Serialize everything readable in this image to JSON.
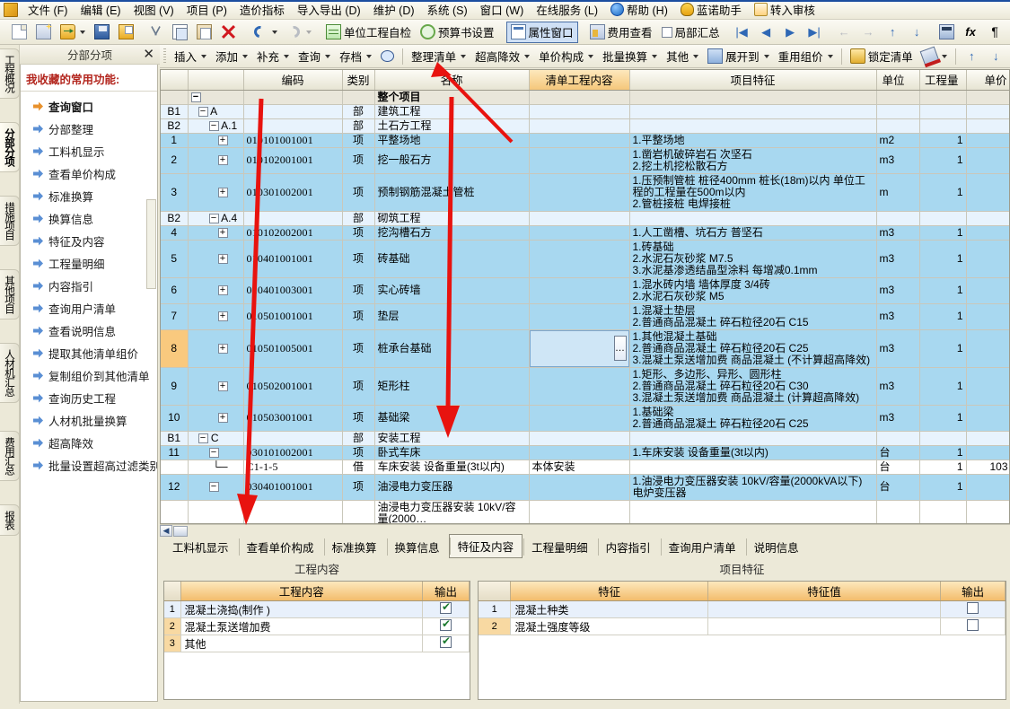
{
  "menubar": {
    "items": [
      {
        "label": "文件 (F)"
      },
      {
        "label": "编辑 (E)"
      },
      {
        "label": "视图 (V)"
      },
      {
        "label": "项目 (P)"
      },
      {
        "label": "造价指标"
      },
      {
        "label": "导入导出 (D)"
      },
      {
        "label": "维护 (D)"
      },
      {
        "label": "系统 (S)"
      },
      {
        "label": "窗口 (W)"
      },
      {
        "label": "在线服务 (L)"
      },
      {
        "label": "帮助 (H)",
        "icon": "help-icon"
      },
      {
        "label": "蓝诺助手",
        "icon": "helmet-icon"
      },
      {
        "label": "转入审核",
        "icon": "audit-icon"
      }
    ]
  },
  "toolbar1": {
    "buttons": [
      {
        "name": "new-document",
        "icon": "new-document-icon",
        "label": ""
      },
      {
        "name": "new-project",
        "icon": "new-project-icon",
        "label": ""
      },
      {
        "name": "open",
        "icon": "open-folder-icon",
        "label": "",
        "dropdown": true
      },
      {
        "name": "save",
        "icon": "save-icon",
        "label": ""
      },
      {
        "name": "save-as",
        "icon": "save-as-icon",
        "label": ""
      },
      {
        "name": "cut",
        "icon": "scissors-icon",
        "label": ""
      },
      {
        "name": "copy",
        "icon": "copy-icon",
        "label": ""
      },
      {
        "name": "paste",
        "icon": "paste-icon",
        "label": ""
      },
      {
        "name": "delete",
        "icon": "delete-x-icon",
        "label": ""
      },
      {
        "name": "undo",
        "icon": "undo-icon",
        "label": "",
        "dropdown": true
      },
      {
        "name": "redo",
        "icon": "redo-icon",
        "label": "",
        "dropdown": true,
        "disabled": true
      }
    ],
    "labeled": [
      {
        "name": "unit-project-self-check",
        "icon": "grid-check-icon",
        "label": "单位工程自检"
      },
      {
        "name": "budget-book-settings",
        "icon": "gear-icon",
        "label": "预算书设置"
      },
      {
        "name": "property-window",
        "icon": "property-window-icon",
        "label": "属性窗口",
        "active": true
      },
      {
        "name": "fee-view",
        "icon": "fee-icon",
        "label": "费用查看"
      },
      {
        "name": "local-summary",
        "icon": "checkbox-icon",
        "label": "局部汇总"
      }
    ],
    "nav": [
      {
        "name": "first-record",
        "glyph": "|◀"
      },
      {
        "name": "prev-record",
        "glyph": "◀"
      },
      {
        "name": "next-record",
        "glyph": "▶"
      },
      {
        "name": "last-record",
        "glyph": "▶|"
      }
    ],
    "nav2": [
      {
        "name": "back",
        "glyph": "←",
        "disabled": true
      },
      {
        "name": "forward",
        "glyph": "→",
        "disabled": true
      },
      {
        "name": "move-up",
        "glyph": "↑"
      },
      {
        "name": "move-down",
        "glyph": "↓"
      }
    ],
    "tools": [
      {
        "name": "calculator",
        "icon": "calculator-icon"
      },
      {
        "name": "formula",
        "icon": "fx-icon",
        "glyph": "fx"
      },
      {
        "name": "paragraph",
        "icon": "paragraph-icon",
        "glyph": "¶"
      },
      {
        "name": "book",
        "icon": "book-icon"
      },
      {
        "name": "list",
        "icon": "list-icon"
      }
    ]
  },
  "toolbar2": {
    "buttons": [
      {
        "name": "insert",
        "label": "插入",
        "dropdown": true
      },
      {
        "name": "add",
        "label": "添加",
        "dropdown": true
      },
      {
        "name": "supplement",
        "label": "补充",
        "dropdown": true
      },
      {
        "name": "query",
        "label": "查询",
        "dropdown": true
      },
      {
        "name": "archive",
        "label": "存档",
        "dropdown": true
      },
      {
        "name": "find",
        "label": "",
        "icon": "binoculars-icon"
      },
      {
        "name": "organize-list",
        "label": "整理清单",
        "dropdown": true
      },
      {
        "name": "super-high-derating",
        "label": "超高降效",
        "dropdown": true
      },
      {
        "name": "unit-price-composition",
        "label": "单价构成",
        "dropdown": true
      },
      {
        "name": "batch-conversion",
        "label": "批量换算",
        "dropdown": true
      },
      {
        "name": "other",
        "label": "其他",
        "dropdown": true
      },
      {
        "name": "expand-to",
        "label": "展开到",
        "icon": "expand-icon",
        "dropdown": true
      },
      {
        "name": "reuse-pricing",
        "label": "重用组价",
        "dropdown": true
      },
      {
        "name": "lock-list",
        "label": "锁定清单",
        "icon": "lock-icon"
      },
      {
        "name": "format-painter",
        "label": "",
        "icon": "paint-icon",
        "dropdown": true
      },
      {
        "name": "move-up",
        "label": "",
        "icon": "arrow-up-icon"
      },
      {
        "name": "move-down",
        "label": "",
        "icon": "arrow-down-icon"
      }
    ]
  },
  "vtabs": [
    {
      "label": "工程概况",
      "selected": false
    },
    {
      "label": "分部分项",
      "selected": true
    },
    {
      "label": "措施项目",
      "selected": false
    },
    {
      "label": "其他项目",
      "selected": false
    },
    {
      "label": "人材机汇总",
      "selected": false
    },
    {
      "label": "费用汇总",
      "selected": false
    },
    {
      "label": "报表",
      "selected": false
    }
  ],
  "sidebar": {
    "header": "分部分项",
    "close": "✕",
    "title": "我收藏的常用功能:",
    "items": [
      {
        "label": "查询窗口"
      },
      {
        "label": "分部整理"
      },
      {
        "label": "工料机显示"
      },
      {
        "label": "查看单价构成"
      },
      {
        "label": "标准换算"
      },
      {
        "label": "换算信息"
      },
      {
        "label": "特征及内容"
      },
      {
        "label": "工程量明细"
      },
      {
        "label": "内容指引"
      },
      {
        "label": "查询用户清单"
      },
      {
        "label": "查看说明信息"
      },
      {
        "label": "提取其他清单组价"
      },
      {
        "label": "复制组价到其他清单"
      },
      {
        "label": "查询历史工程"
      },
      {
        "label": "人材机批量换算"
      },
      {
        "label": "超高降效"
      },
      {
        "label": "批量设置超高过滤类别"
      }
    ]
  },
  "grid": {
    "columns": [
      {
        "key": "no",
        "label": ""
      },
      {
        "key": "tree",
        "label": ""
      },
      {
        "key": "code",
        "label": "编码"
      },
      {
        "key": "cat",
        "label": "类别"
      },
      {
        "key": "name",
        "label": "名称"
      },
      {
        "key": "qdc",
        "label": "清单工程内容",
        "highlight": true
      },
      {
        "key": "feat",
        "label": "项目特征"
      },
      {
        "key": "unit",
        "label": "单位"
      },
      {
        "key": "qty",
        "label": "工程量"
      },
      {
        "key": "price",
        "label": "单价"
      }
    ],
    "rows": [
      {
        "no": "",
        "style": "root",
        "tree": "−",
        "code": "",
        "cat": "",
        "name": "整个项目",
        "qdc": "",
        "feat": "",
        "unit": "",
        "qty": "",
        "price": ""
      },
      {
        "no": "B1",
        "style": "dept",
        "tree": "−",
        "treeLabel": "A",
        "indent": 1,
        "code": "",
        "cat": "部",
        "name": "建筑工程",
        "qdc": "",
        "feat": "",
        "unit": "",
        "qty": "",
        "price": ""
      },
      {
        "no": "B2",
        "style": "dept",
        "tree": "−",
        "treeLabel": "A.1",
        "indent": 2,
        "code": "",
        "cat": "部",
        "name": "土石方工程",
        "qdc": "",
        "feat": "",
        "unit": "",
        "qty": "",
        "price": ""
      },
      {
        "no": "1",
        "style": "item",
        "tree": "+",
        "indent": 3,
        "code": "010101001001",
        "cat": "项",
        "name": "平整场地",
        "qdc": "",
        "feat": "1.平整场地",
        "unit": "m2",
        "qty": "1",
        "price": ""
      },
      {
        "no": "2",
        "style": "item",
        "tree": "+",
        "indent": 3,
        "code": "010102001001",
        "cat": "项",
        "name": "挖一般石方",
        "qdc": "",
        "feat": "1.凿岩机破碎岩石  次坚石\n2.挖土机挖松散石方",
        "unit": "m3",
        "qty": "1",
        "price": ""
      },
      {
        "no": "3",
        "style": "item",
        "tree": "+",
        "indent": 3,
        "code": "010301002001",
        "cat": "项",
        "name": "预制钢筋混凝土管桩",
        "qdc": "",
        "feat": "1.压预制管桩  桩径400mm  桩长(18m)以内  单位工程的工程量在500m以内\n2.管桩接桩  电焊接桩",
        "unit": "m",
        "qty": "1",
        "price": ""
      },
      {
        "no": "B2",
        "style": "dept",
        "tree": "−",
        "treeLabel": "A.4",
        "indent": 2,
        "code": "",
        "cat": "部",
        "name": "砌筑工程",
        "qdc": "",
        "feat": "",
        "unit": "",
        "qty": "",
        "price": ""
      },
      {
        "no": "4",
        "style": "item",
        "tree": "+",
        "indent": 3,
        "code": "010102002001",
        "cat": "项",
        "name": "挖沟槽石方",
        "qdc": "",
        "feat": "1.人工凿槽、坑石方  普坚石",
        "unit": "m3",
        "qty": "1",
        "price": ""
      },
      {
        "no": "5",
        "style": "item",
        "tree": "+",
        "indent": 3,
        "code": "010401001001",
        "cat": "项",
        "name": "砖基础",
        "qdc": "",
        "feat": "1.砖基础\n2.水泥石灰砂浆  M7.5\n3.水泥基渗透结晶型涂料  每增减0.1mm",
        "unit": "m3",
        "qty": "1",
        "price": ""
      },
      {
        "no": "6",
        "style": "item",
        "tree": "+",
        "indent": 3,
        "code": "010401003001",
        "cat": "项",
        "name": "实心砖墙",
        "qdc": "",
        "feat": "1.混水砖内墙  墙体厚度  3/4砖\n2.水泥石灰砂浆  M5",
        "unit": "m3",
        "qty": "1",
        "price": ""
      },
      {
        "no": "7",
        "style": "item",
        "tree": "+",
        "indent": 3,
        "code": "010501001001",
        "cat": "项",
        "name": "垫层",
        "qdc": "",
        "feat": "1.混凝土垫层\n2.普通商品混凝土  碎石粒径20石 C15",
        "unit": "m3",
        "qty": "1",
        "price": ""
      },
      {
        "no": "8",
        "style": "sel",
        "tree": "+",
        "indent": 3,
        "code": "010501005001",
        "cat": "项",
        "name": "桩承台基础",
        "qdc": "",
        "qdcSelected": true,
        "feat": "1.其他混凝土基础\n2.普通商品混凝土  碎石粒径20石  C25\n3.混凝土泵送增加费  商品混凝土 (不计算超高降效)",
        "unit": "m3",
        "qty": "1",
        "price": ""
      },
      {
        "no": "9",
        "style": "item",
        "tree": "+",
        "indent": 3,
        "code": "010502001001",
        "cat": "项",
        "name": "矩形柱",
        "qdc": "",
        "feat": "1.矩形、多边形、异形、圆形柱\n2.普通商品混凝土  碎石粒径20石 C30\n3.混凝土泵送增加费  商品混凝土 (计算超高降效)",
        "unit": "m3",
        "qty": "1",
        "price": ""
      },
      {
        "no": "10",
        "style": "item",
        "tree": "+",
        "indent": 3,
        "code": "010503001001",
        "cat": "项",
        "name": "基础梁",
        "qdc": "",
        "feat": "1.基础梁\n2.普通商品混凝土  碎石粒径20石 C25",
        "unit": "m3",
        "qty": "1",
        "price": ""
      },
      {
        "no": "B1",
        "style": "dept",
        "tree": "−",
        "treeLabel": "C",
        "indent": 1,
        "code": "",
        "cat": "部",
        "name": "安装工程",
        "qdc": "",
        "feat": "",
        "unit": "",
        "qty": "",
        "price": ""
      },
      {
        "no": "11",
        "style": "item",
        "tree": "−",
        "indent": 2,
        "code": "030101002001",
        "cat": "项",
        "name": "卧式车床",
        "qdc": "",
        "feat": "1.车床安装  设备重量(3t以内)",
        "unit": "台",
        "qty": "1",
        "price": ""
      },
      {
        "no": "",
        "style": "sub",
        "tree": "",
        "indent": 4,
        "code": "C1-1-5",
        "cat": "借",
        "name": "车床安装  设备重量(3t以内)",
        "qdc": "本体安装",
        "feat": "",
        "unit": "台",
        "qty": "1",
        "price": "103"
      },
      {
        "no": "12",
        "style": "item",
        "tree": "−",
        "indent": 2,
        "code": "030401001001",
        "cat": "项",
        "name": "油浸电力变压器",
        "qdc": "",
        "feat": "1.油浸电力变压器安装  10kV/容量(2000kVA以下)\n电炉变压器",
        "unit": "台",
        "qty": "1",
        "price": ""
      },
      {
        "no": "",
        "style": "sub",
        "tree": "",
        "indent": 4,
        "code": "",
        "cat": "",
        "name": "油浸电力变压器安装  10kV/容量(2000…",
        "qdc": "",
        "feat": "",
        "unit": "",
        "qty": "",
        "price": ""
      }
    ]
  },
  "bottom": {
    "tabs": [
      {
        "label": "工料机显示",
        "selected": false
      },
      {
        "label": "查看单价构成",
        "selected": false
      },
      {
        "label": "标准换算",
        "selected": false
      },
      {
        "label": "换算信息",
        "selected": false
      },
      {
        "label": "特征及内容",
        "selected": true
      },
      {
        "label": "工程量明细",
        "selected": false
      },
      {
        "label": "内容指引",
        "selected": false
      },
      {
        "label": "查询用户清单",
        "selected": false
      },
      {
        "label": "说明信息",
        "selected": false
      }
    ],
    "left": {
      "title": "工程内容",
      "columns": [
        "",
        "工程内容",
        "输出"
      ],
      "rows": [
        {
          "idx": "1",
          "content": "混凝土浇捣(制作 )",
          "output": true,
          "selected": true
        },
        {
          "idx": "2",
          "content": "混凝土泵送增加费",
          "output": true,
          "selected": false
        },
        {
          "idx": "3",
          "content": "其他",
          "output": true,
          "selected": false
        }
      ]
    },
    "right": {
      "title": "项目特征",
      "columns": [
        "",
        "特征",
        "特征值",
        "输出"
      ],
      "rows": [
        {
          "idx": "1",
          "feature": "混凝土种类",
          "value": "",
          "output": false,
          "selected": true
        },
        {
          "idx": "2",
          "feature": "混凝土强度等级",
          "value": "",
          "output": false,
          "selected": false
        }
      ]
    }
  },
  "annotations": {
    "color": "#e8130f",
    "arrows": [
      {
        "name": "arrow-to-organize-list"
      },
      {
        "name": "arrow-code-column"
      },
      {
        "name": "arrow-name-column"
      }
    ]
  }
}
